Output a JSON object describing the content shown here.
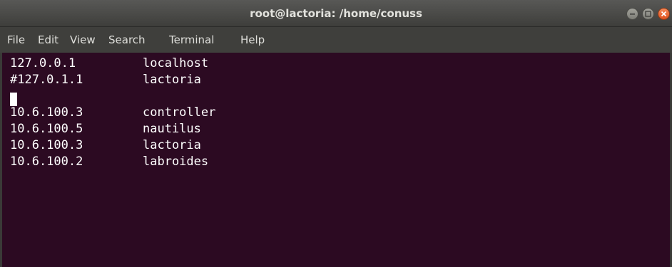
{
  "window": {
    "title": "root@lactoria: /home/conuss"
  },
  "menu": [
    "File",
    "Edit",
    "View",
    "Search",
    "Terminal",
    "Help"
  ],
  "terminal": {
    "lines": [
      {
        "ip": "127.0.0.1",
        "host": "localhost"
      },
      {
        "ip": "#127.0.1.1",
        "host": "lactoria"
      },
      {
        "ip": "",
        "host": ""
      },
      {
        "ip": "10.6.100.3",
        "host": "controller"
      },
      {
        "ip": "10.6.100.5",
        "host": "nautilus"
      },
      {
        "ip": "10.6.100.3",
        "host": "lactoria"
      },
      {
        "ip": "10.6.100.2",
        "host": "labroides"
      }
    ]
  },
  "colors": {
    "terminal_bg": "#2c0a22",
    "titlebar": "#4a4a47",
    "close_button": "#e95420"
  },
  "icons": [
    "minimize-icon",
    "maximize-icon",
    "close-icon"
  ]
}
